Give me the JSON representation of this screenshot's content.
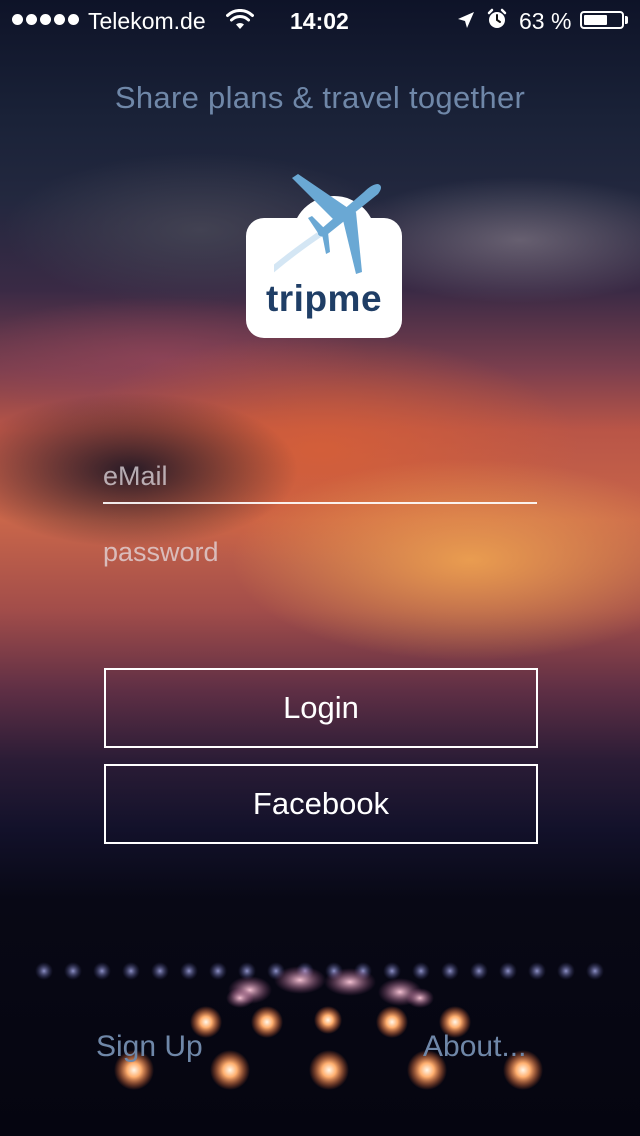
{
  "status_bar": {
    "carrier": "Telekom.de",
    "time": "14:02",
    "battery_percent": "63 %",
    "battery_level": 0.63,
    "signal_icon": "signal-dots-icon",
    "wifi_icon": "wifi-icon",
    "location_icon": "location-arrow-icon",
    "alarm_icon": "alarm-clock-icon",
    "battery_icon": "battery-icon"
  },
  "header": {
    "tagline": "Share plans & travel together"
  },
  "logo": {
    "text": "tripme",
    "icon": "airplane-cloud-icon",
    "text_color": "#1f3e66",
    "plane_color": "#6aa8d4"
  },
  "form": {
    "email_placeholder": "eMail",
    "email_value": "",
    "password_placeholder": "password",
    "password_value": "",
    "login_label": "Login",
    "facebook_label": "Facebook"
  },
  "footer": {
    "signup_label": "Sign Up",
    "about_label": "About..."
  },
  "colors": {
    "accent_text": "#6f87a8",
    "button_border": "#ffffff"
  }
}
